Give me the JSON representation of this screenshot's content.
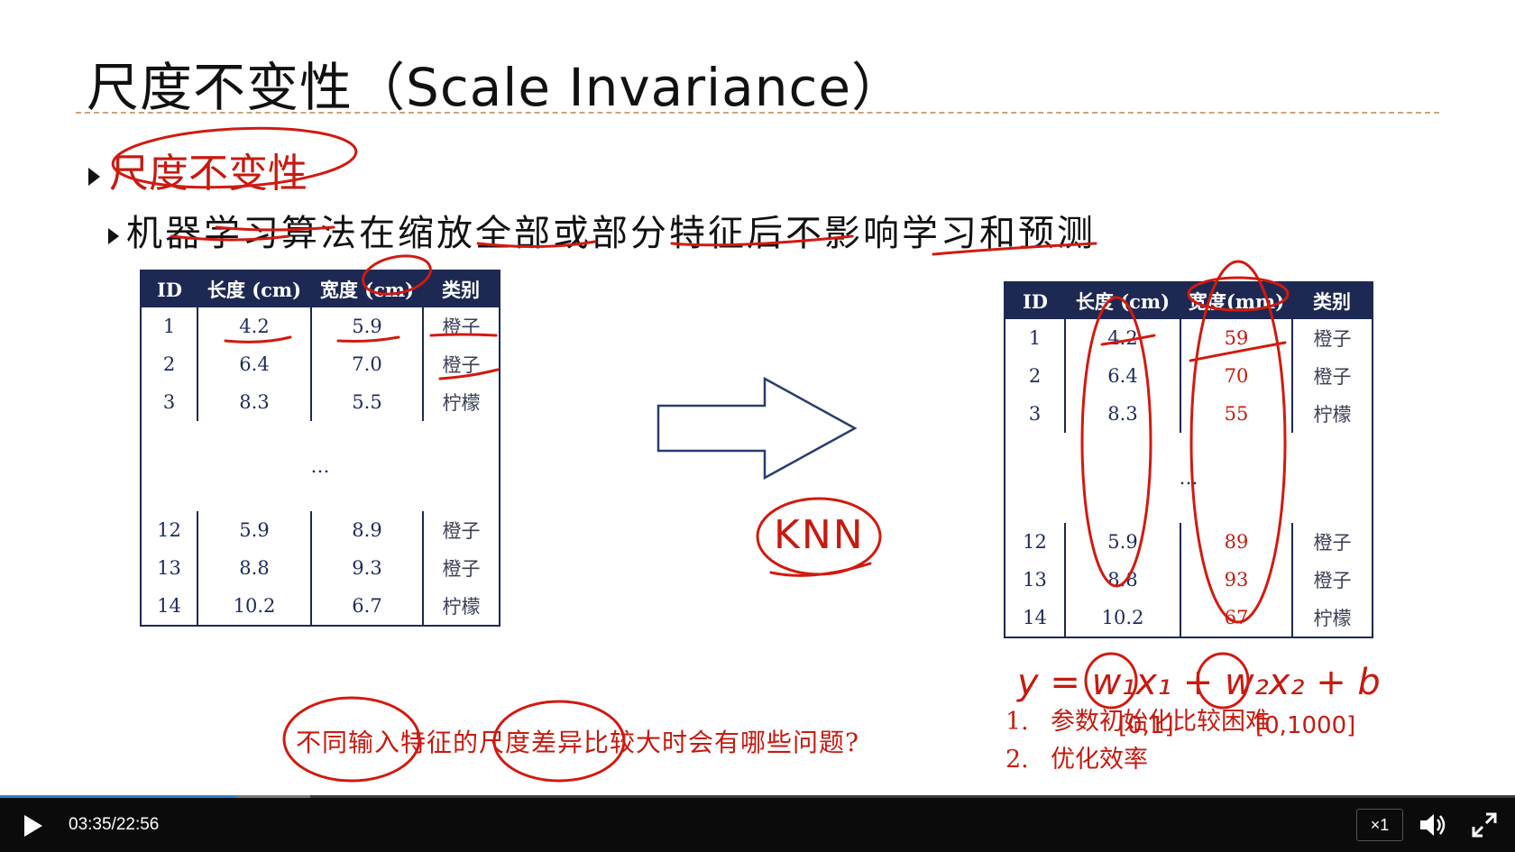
{
  "slide": {
    "title": "尺度不变性（Scale Invariance）",
    "bullet1": "尺度不变性",
    "bullet2": "机器学习算法在缩放全部或部分特征后不影响学习和预测"
  },
  "table_left": {
    "headers": [
      "ID",
      "长度 (cm)",
      "宽度 (cm)",
      "类别"
    ],
    "rows": [
      [
        "1",
        "4.2",
        "5.9",
        "橙子"
      ],
      [
        "2",
        "6.4",
        "7.0",
        "橙子"
      ],
      [
        "3",
        "8.3",
        "5.5",
        "柠檬"
      ],
      [
        "12",
        "5.9",
        "8.9",
        "橙子"
      ],
      [
        "13",
        "8.8",
        "9.3",
        "橙子"
      ],
      [
        "14",
        "10.2",
        "6.7",
        "柠檬"
      ]
    ],
    "ellipsis": "…"
  },
  "table_right": {
    "headers": [
      "ID",
      "长度 (cm)",
      "宽度(mm)",
      "类别"
    ],
    "rows": [
      [
        "1",
        "4.2",
        "59",
        "橙子"
      ],
      [
        "2",
        "6.4",
        "70",
        "橙子"
      ],
      [
        "3",
        "8.3",
        "55",
        "柠檬"
      ],
      [
        "12",
        "5.9",
        "89",
        "橙子"
      ],
      [
        "13",
        "8.8",
        "93",
        "橙子"
      ],
      [
        "14",
        "10.2",
        "67",
        "柠檬"
      ]
    ],
    "ellipsis": "…"
  },
  "annotations": {
    "knn": "KNN",
    "formula": "y = w₁x₁ + w₂x₂ + b",
    "range1": "[0,1]",
    "range2": "[0,1000]"
  },
  "question": "不同输入特征的尺度差异比较大时会有哪些问题?",
  "issues": [
    {
      "num": "1.",
      "text": "参数初始化比较困难"
    },
    {
      "num": "2.",
      "text": "优化效率"
    }
  ],
  "player": {
    "current_time": "03:35",
    "separator": "/",
    "duration": "22:56",
    "speed": "×1",
    "progress_fraction": 0.156,
    "buffered_fraction": 0.205,
    "accent": "#2f7fd8"
  },
  "colors": {
    "ink": "#c61a10",
    "table_header": "#1d2952",
    "table_text": "#1d2a5c"
  }
}
